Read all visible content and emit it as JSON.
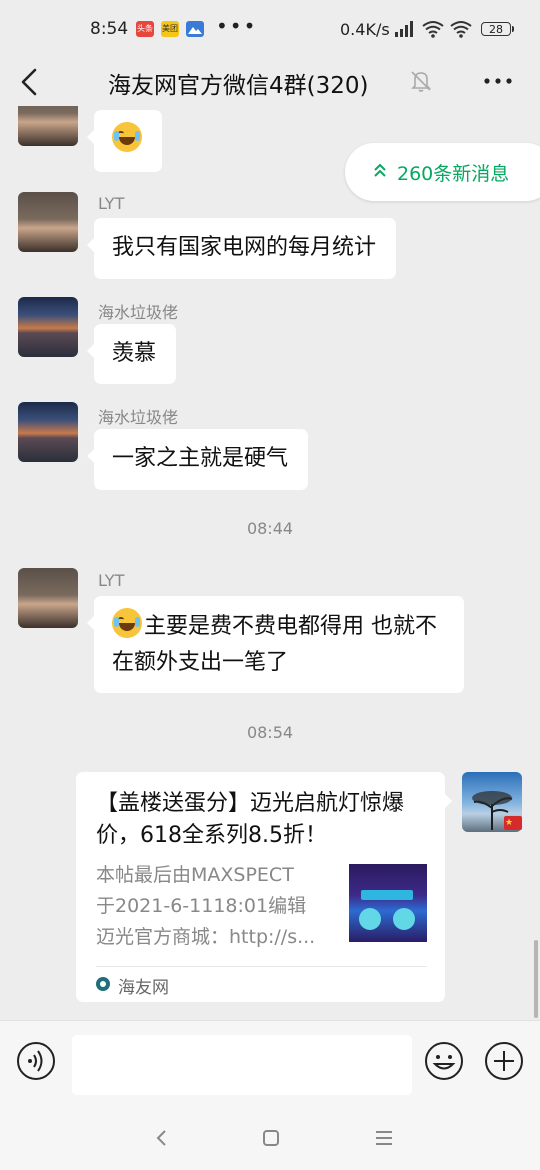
{
  "status_bar": {
    "time": "8:54",
    "app_icons": [
      {
        "name": "toutiao-icon",
        "text": "头条",
        "color": "#e8453c"
      },
      {
        "name": "meituan-icon",
        "text": "美团",
        "color": "#f5c518"
      },
      {
        "name": "gallery-icon",
        "text": "",
        "color": "#3b7bd8"
      }
    ],
    "more": "•••",
    "net_speed": "0.4K/s",
    "battery": "28"
  },
  "header": {
    "title": "海友网官方微信4群(320)"
  },
  "new_messages_pill": {
    "label": "260条新消息"
  },
  "messages": [
    {
      "sender": "",
      "text": "",
      "emoji": "laugh-cry"
    },
    {
      "sender": "LYT",
      "text": "我只有国家电网的每月统计"
    },
    {
      "sender": "海水垃圾佬",
      "text": "羡慕"
    },
    {
      "sender": "海水垃圾佬",
      "text": "一家之主就是硬气"
    },
    {
      "sender": "LYT",
      "text": "主要是费不费电都得用  也就不在额外支出一笔了",
      "emoji": "laugh-cry"
    }
  ],
  "timestamps": [
    "08:44",
    "08:54"
  ],
  "link_card": {
    "title": "【盖楼送蛋分】迈光启航灯惊爆价，618全系列8.5折！",
    "description": "本帖最后由MAXSPECT\n于2021-6-1118:01编辑\n迈光官方商城：http://s...",
    "source": "海友网"
  },
  "input": {
    "placeholder": ""
  },
  "colors": {
    "accent_green": "#07a860",
    "background": "#ededed",
    "bubble": "#ffffff"
  }
}
